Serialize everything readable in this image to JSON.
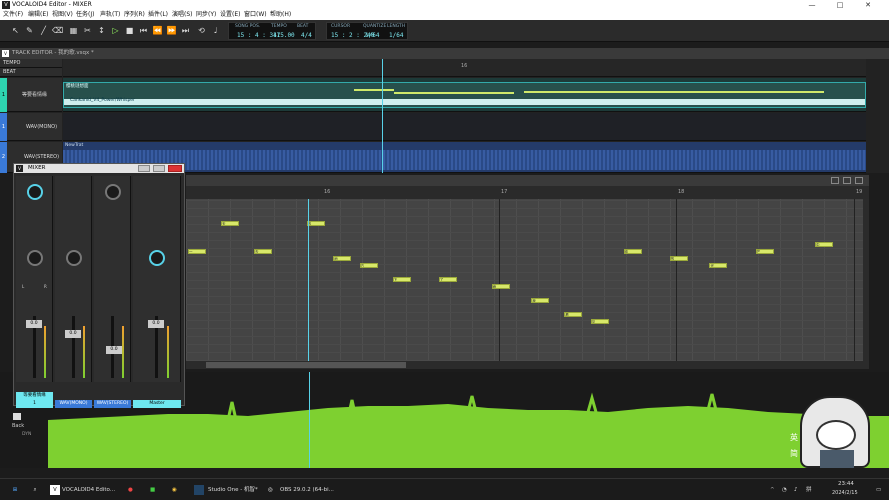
{
  "window": {
    "title": "VOCALOID4 Editor - MIXER",
    "controls": [
      "—",
      "□",
      "✕"
    ]
  },
  "menu": [
    "文件(F)",
    "编辑(E)",
    "视图(V)",
    "任务(J)",
    "声轨(T)",
    "序列(R)",
    "插件(L)",
    "演唱(S)",
    "同步(Y)",
    "设置(E)",
    "窗口(W)",
    "帮助(H)"
  ],
  "transport": {
    "song_pos_label": "SONG POS.",
    "song_pos": "15 : 4 : 347",
    "tempo_label": "TEMPO",
    "tempo": "115.00",
    "beat_label": "BEAT",
    "beat": "4/4",
    "cursor_label": "CURSOR",
    "cursor": "15 : 2 : 240",
    "quantize_label": "QUANTIZE",
    "quantize": "1/64",
    "length_label": "LENGTH",
    "length": "1/64"
  },
  "track_editor": {
    "title": "TRACK EDITOR - 我的歌.vsqx *",
    "ruler_rows": [
      "TEMPO",
      "BEAT"
    ],
    "bar_marker": "16",
    "tracks": [
      {
        "num": "1",
        "name": "等要看情缘",
        "part_label": "樱桃谜想面",
        "voicebank": "Cankanid_V4_Power/Whisper",
        "color": "#2ed4b0"
      },
      {
        "num": "1",
        "name": "WAV(MONO)",
        "color": "#3a7ad8"
      },
      {
        "num": "2",
        "name": "WAV(STEREO)",
        "part_label": "NewTrat",
        "color": "#3a7ad8"
      }
    ]
  },
  "piano_roll": {
    "bar_markers": [
      "16",
      "17",
      "18",
      "19"
    ],
    "notes": [
      {
        "label": "一",
        "bar": 0.0,
        "row": 6
      },
      {
        "label": "天",
        "bar": 0.05,
        "row": 2
      },
      {
        "label": "去",
        "bar": 0.1,
        "row": 6
      },
      {
        "label": "的",
        "bar": 0.18,
        "row": 2
      },
      {
        "label": "地",
        "bar": 0.22,
        "row": 7
      },
      {
        "label": "方",
        "bar": 0.26,
        "row": 8
      },
      {
        "label": "下",
        "bar": 0.31,
        "row": 10
      },
      {
        "label": "了",
        "bar": 0.38,
        "row": 10
      },
      {
        "label": "雨",
        "bar": 0.46,
        "row": 11
      },
      {
        "label": "我",
        "bar": 0.52,
        "row": 13
      },
      {
        "label": "看",
        "bar": 0.57,
        "row": 15
      },
      {
        "label": "见",
        "bar": 0.61,
        "row": 16
      },
      {
        "label": "你",
        "bar": 0.66,
        "row": 6
      },
      {
        "label": "的",
        "bar": 0.73,
        "row": 7
      },
      {
        "label": "光",
        "bar": 0.79,
        "row": 8
      },
      {
        "label": "芒",
        "bar": 0.86,
        "row": 6
      },
      {
        "label": "中",
        "bar": 0.95,
        "row": 5
      }
    ]
  },
  "mixer": {
    "title": "MIXER",
    "channels": [
      {
        "label": "等要看情缘",
        "color": "#6ee8f0",
        "vol": "0.0"
      },
      {
        "label": "WAV(MONO)",
        "color": "#3a7ad8",
        "vol": "0.0"
      },
      {
        "label": "WAV(STEREO)",
        "color": "#3a7ad8",
        "vol": "0.0"
      },
      {
        "label": "Master",
        "color": "#6ee8f0",
        "vol": "0.0"
      }
    ],
    "pan_letters": [
      "L",
      "R"
    ],
    "footer_num": "1"
  },
  "wave": {
    "back_label": "Back",
    "dyn_label": "DYN"
  },
  "taskbar": {
    "apps": [
      "VOCALOID4 Edito...",
      "Studio One - 机智*",
      "OBS 29.0.2 (64-bi..."
    ],
    "clock_time": "23:44",
    "clock_date": "2024/2/15",
    "ime": "英",
    "ime2": "简"
  },
  "colors": {
    "accent": "#58d2e8",
    "note": "#d8e86a",
    "wave": "#7ed030"
  }
}
